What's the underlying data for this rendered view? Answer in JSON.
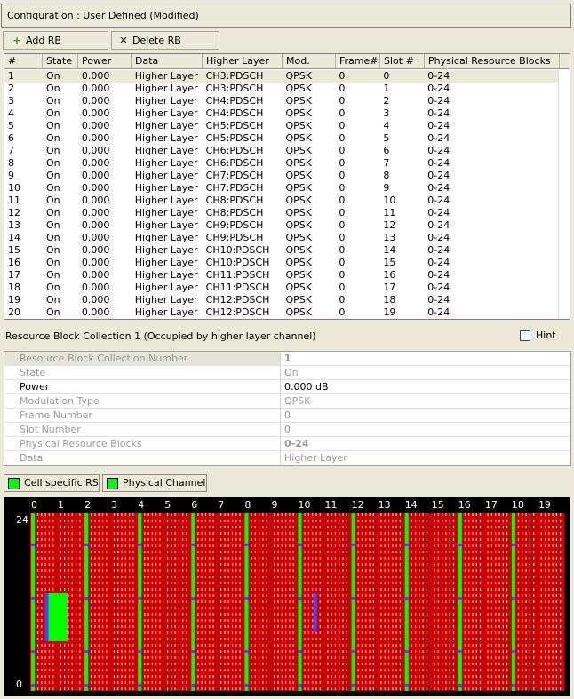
{
  "config": {
    "label": "Configuration : User Defined (Modified)"
  },
  "toolbar": {
    "add_label": "Add RB",
    "add_icon": "plus-icon",
    "delete_label": "Delete RB",
    "delete_icon": "x-icon"
  },
  "table": {
    "columns": [
      "#",
      "State",
      "Power",
      "Data",
      "Higher Layer",
      "Mod.",
      "Frame#",
      "Slot #",
      "Physical Resource Blocks"
    ],
    "rows": [
      [
        "1",
        "On",
        "0.000",
        "Higher Layer",
        "CH3:PDSCH",
        "QPSK",
        "0",
        "0",
        "0-24"
      ],
      [
        "2",
        "On",
        "0.000",
        "Higher Layer",
        "CH3:PDSCH",
        "QPSK",
        "0",
        "1",
        "0-24"
      ],
      [
        "3",
        "On",
        "0.000",
        "Higher Layer",
        "CH4:PDSCH",
        "QPSK",
        "0",
        "2",
        "0-24"
      ],
      [
        "4",
        "On",
        "0.000",
        "Higher Layer",
        "CH4:PDSCH",
        "QPSK",
        "0",
        "3",
        "0-24"
      ],
      [
        "5",
        "On",
        "0.000",
        "Higher Layer",
        "CH5:PDSCH",
        "QPSK",
        "0",
        "4",
        "0-24"
      ],
      [
        "6",
        "On",
        "0.000",
        "Higher Layer",
        "CH5:PDSCH",
        "QPSK",
        "0",
        "5",
        "0-24"
      ],
      [
        "7",
        "On",
        "0.000",
        "Higher Layer",
        "CH6:PDSCH",
        "QPSK",
        "0",
        "6",
        "0-24"
      ],
      [
        "8",
        "On",
        "0.000",
        "Higher Layer",
        "CH6:PDSCH",
        "QPSK",
        "0",
        "7",
        "0-24"
      ],
      [
        "9",
        "On",
        "0.000",
        "Higher Layer",
        "CH7:PDSCH",
        "QPSK",
        "0",
        "8",
        "0-24"
      ],
      [
        "10",
        "On",
        "0.000",
        "Higher Layer",
        "CH7:PDSCH",
        "QPSK",
        "0",
        "9",
        "0-24"
      ],
      [
        "11",
        "On",
        "0.000",
        "Higher Layer",
        "CH8:PDSCH",
        "QPSK",
        "0",
        "10",
        "0-24"
      ],
      [
        "12",
        "On",
        "0.000",
        "Higher Layer",
        "CH8:PDSCH",
        "QPSK",
        "0",
        "11",
        "0-24"
      ],
      [
        "13",
        "On",
        "0.000",
        "Higher Layer",
        "CH9:PDSCH",
        "QPSK",
        "0",
        "12",
        "0-24"
      ],
      [
        "14",
        "On",
        "0.000",
        "Higher Layer",
        "CH9:PDSCH",
        "QPSK",
        "0",
        "13",
        "0-24"
      ],
      [
        "15",
        "On",
        "0.000",
        "Higher Layer",
        "CH10:PDSCH",
        "QPSK",
        "0",
        "14",
        "0-24"
      ],
      [
        "16",
        "On",
        "0.000",
        "Higher Layer",
        "CH10:PDSCH",
        "QPSK",
        "0",
        "15",
        "0-24"
      ],
      [
        "17",
        "On",
        "0.000",
        "Higher Layer",
        "CH11:PDSCH",
        "QPSK",
        "0",
        "16",
        "0-24"
      ],
      [
        "18",
        "On",
        "0.000",
        "Higher Layer",
        "CH11:PDSCH",
        "QPSK",
        "0",
        "17",
        "0-24"
      ],
      [
        "19",
        "On",
        "0.000",
        "Higher Layer",
        "CH12:PDSCH",
        "QPSK",
        "0",
        "18",
        "0-24"
      ],
      [
        "20",
        "On",
        "0.000",
        "Higher Layer",
        "CH12:PDSCH",
        "QPSK",
        "0",
        "19",
        "0-24"
      ]
    ],
    "selected_row": 0
  },
  "rbc": {
    "title": "Resource Block Collection 1 (Occupied by higher layer channel)",
    "hint_label": "Hint",
    "hint_checked": false
  },
  "props": [
    {
      "label": "Resource Block Collection Number",
      "value": "1"
    },
    {
      "label": "State",
      "value": "On"
    },
    {
      "label": "Power",
      "value": "0.000 dB"
    },
    {
      "label": "Modulation Type",
      "value": "QPSK"
    },
    {
      "label": "Frame Number",
      "value": "0"
    },
    {
      "label": "Slot Number",
      "value": "0"
    },
    {
      "label": "Physical Resource Blocks",
      "value": "0-24"
    },
    {
      "label": "Data",
      "value": "Higher Layer"
    }
  ],
  "legend": {
    "rs_label": "Cell specific RS",
    "pc_label": "Physical Channel",
    "swatch_color": "#00ff00"
  },
  "chart_data": {
    "type": "heatmap",
    "x_ticks": [
      "0",
      "1",
      "2",
      "3",
      "4",
      "5",
      "6",
      "7",
      "8",
      "9",
      "10",
      "11",
      "12",
      "13",
      "14",
      "15",
      "16",
      "17",
      "18",
      "19"
    ],
    "y_ticks": [
      "24",
      "0"
    ],
    "colors": {
      "background": "#000000",
      "fill": "#cc0000",
      "rs": "#00ff00",
      "marker": "#4444ff",
      "hatch": "#ffffff"
    }
  }
}
